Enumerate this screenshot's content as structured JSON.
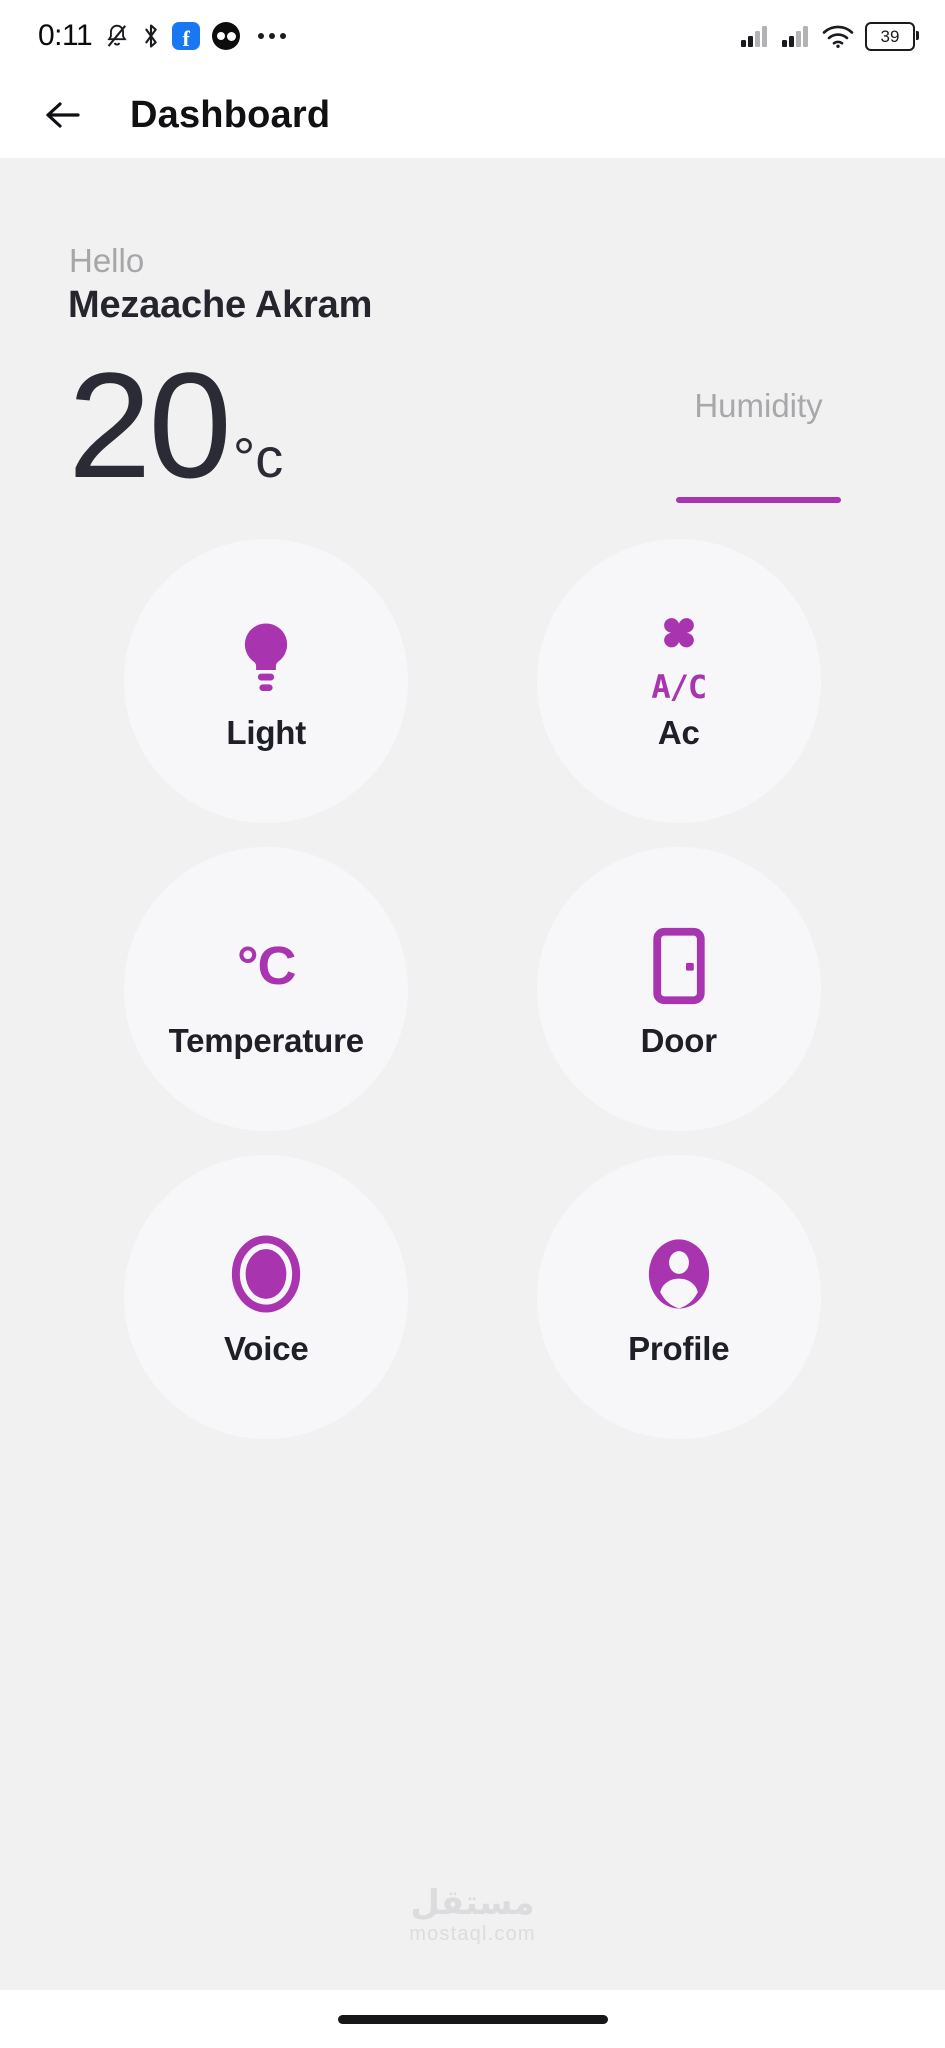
{
  "theme": {
    "accent": "#A934B0",
    "page_bg": "#F1F1F2",
    "tile_bg": "#F7F7F9",
    "text_dark": "#1F1F27",
    "text_muted": "#A6A6A8"
  },
  "status_bar": {
    "clock": "0:11",
    "left_icons": [
      "bell-muted-icon",
      "bluetooth-icon",
      "facebook-icon",
      "overflow-app-icon",
      "more-dots-icon"
    ],
    "right_icons": [
      "signal-bars-sim1-icon",
      "signal-bars-sim2-icon",
      "wifi-icon"
    ],
    "battery_level": "39"
  },
  "app_bar": {
    "back_icon": "arrow-left-icon",
    "title": "Dashboard"
  },
  "greeting": {
    "salutation": "Hello",
    "user_name": "Mezaache Akram"
  },
  "metrics": {
    "temperature": {
      "value": "20",
      "unit": "°c"
    },
    "humidity": {
      "label": "Humidity",
      "value": ""
    }
  },
  "tiles": [
    {
      "id": "light",
      "label": "Light",
      "icon": "lightbulb-icon"
    },
    {
      "id": "ac",
      "label": "Ac",
      "icon": "fan-ac-icon",
      "icon_text": "A/C"
    },
    {
      "id": "temperature",
      "label": "Temperature",
      "icon": "celsius-icon",
      "icon_text": "°C"
    },
    {
      "id": "door",
      "label": "Door",
      "icon": "door-icon"
    },
    {
      "id": "voice",
      "label": "Voice",
      "icon": "voice-circle-icon"
    },
    {
      "id": "profile",
      "label": "Profile",
      "icon": "user-avatar-icon"
    }
  ],
  "watermark": {
    "arabic": "مستقل",
    "latin": "mostaql.com"
  },
  "nav_bar": {
    "handle": "home-gesture-handle"
  }
}
